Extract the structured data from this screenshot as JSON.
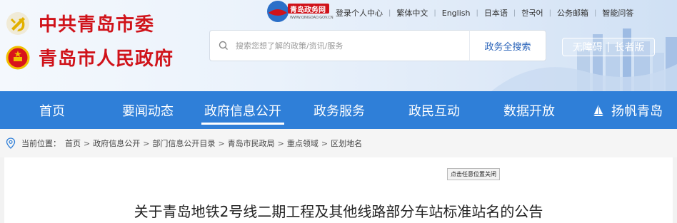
{
  "header": {
    "org_party": "中共青岛市委",
    "org_gov": "青岛市人民政府",
    "logo_text": "青岛政务网",
    "logo_url_text": "WWW.QINGDAO.GOV.CN",
    "top_links": [
      "登录个人中心",
      "繁体中文",
      "English",
      "日本语",
      "한국어",
      "公务邮箱",
      "智能问答"
    ],
    "search": {
      "placeholder": "搜索您想了解的政策/资讯/服务",
      "button": "政务全搜索"
    },
    "accessibility": {
      "barrier_free": "无障碍",
      "elder": "长者版"
    },
    "colors": {
      "org_text": "#d0131a",
      "nav_bg": "#2f7fd8"
    }
  },
  "nav": {
    "items": [
      "首页",
      "要闻动态",
      "政府信息公开",
      "政务服务",
      "政民互动",
      "数据开放",
      "扬帆青岛"
    ],
    "active": "政府信息公开"
  },
  "breadcrumb": {
    "label": "当前位置：",
    "items": [
      "首页",
      "政府信息公开",
      "部门信息公开目录",
      "青岛市民政局",
      "重点领域",
      "区划地名"
    ]
  },
  "article": {
    "close_button": "点击任意位置关闭",
    "title": "关于青岛地铁2号线二期工程及其他线路部分车站标准站名的公告"
  }
}
